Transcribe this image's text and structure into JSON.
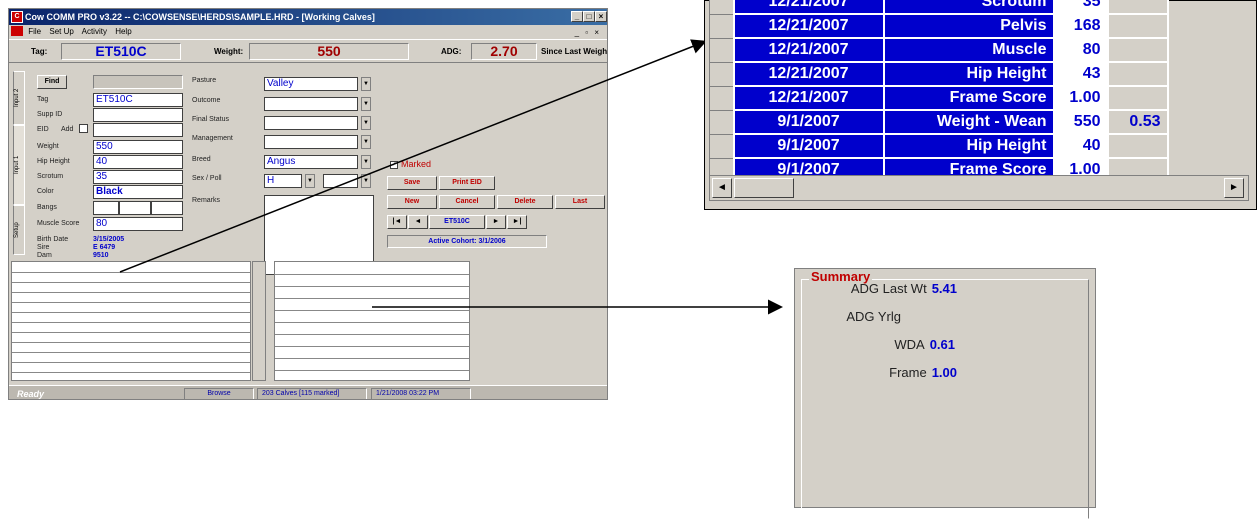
{
  "window": {
    "title": "Cow COMM PRO v3.22 -- C:\\COWSENSE\\HERDS\\SAMPLE.HRD - [Working Calves]",
    "menu": [
      "File",
      "Set Up",
      "Activity",
      "Help"
    ]
  },
  "infobar": {
    "tag_label": "Tag:",
    "tag_value": "ET510C",
    "weight_label": "Weight:",
    "weight_value": "550",
    "adg_label": "ADG:",
    "adg_value": "2.70",
    "since_label": "Since Last Weigh"
  },
  "tabs": [
    "Input 2",
    "Input 1",
    "Setup"
  ],
  "form": {
    "find_button": "Find",
    "tag_label": "Tag",
    "tag_value": "ET510C",
    "supp_label": "Supp ID",
    "eid_label": "EID",
    "add_label": "Add",
    "weight_label": "Weight",
    "weight_value": "550",
    "hip_label": "Hip Height",
    "hip_value": "40",
    "scrotum_label": "Scrotum",
    "scrotum_value": "35",
    "color_label": "Color",
    "color_value": "Black",
    "bangs_label": "Bangs",
    "muscle_label": "Muscle Score",
    "muscle_value": "80",
    "birth_label": "Birth Date",
    "birth_value": "3/15/2005",
    "sire_label": "Sire",
    "sire_value": "E 6479",
    "dam_label": "Dam",
    "dam_value": "9510",
    "pasture_label": "Pasture",
    "pasture_value": "Valley",
    "outcome_label": "Outcome",
    "final_label": "Final Status",
    "mgmt_label": "Management",
    "breed_label": "Breed",
    "breed_value": "Angus",
    "sex_label": "Sex / Poll",
    "sex_value": "H",
    "remarks_label": "Remarks",
    "marked_label": "Marked"
  },
  "buttons": {
    "save": "Save",
    "print_eid": "Print EID",
    "new": "New",
    "cancel": "Cancel",
    "delete": "Delete",
    "last": "Last",
    "nav_first": "|◄",
    "nav_prev": "◄",
    "nav_current": "ET510C",
    "nav_next": "►",
    "nav_last": "►|"
  },
  "cohort": "Active Cohort: 3/1/2006",
  "statusbar": {
    "ready": "Ready",
    "mode": "Browse",
    "count": "203 Calves [115 marked]",
    "datetime": "1/21/2008   03:22 PM"
  },
  "grid": {
    "rows": [
      {
        "date": "12/21/2007",
        "trait": "Scrotum",
        "value": "35",
        "extra": ""
      },
      {
        "date": "12/21/2007",
        "trait": "Pelvis",
        "value": "168",
        "extra": ""
      },
      {
        "date": "12/21/2007",
        "trait": "Muscle",
        "value": "80",
        "extra": ""
      },
      {
        "date": "12/21/2007",
        "trait": "Hip Height",
        "value": "43",
        "extra": ""
      },
      {
        "date": "12/21/2007",
        "trait": "Frame Score",
        "value": "1.00",
        "extra": ""
      },
      {
        "date": "9/1/2007",
        "trait": "Weight - Wean",
        "value": "550",
        "extra": "0.53"
      },
      {
        "date": "9/1/2007",
        "trait": "Hip Height",
        "value": "40",
        "extra": ""
      },
      {
        "date": "9/1/2007",
        "trait": "Frame Score",
        "value": "1.00",
        "extra": ""
      }
    ]
  },
  "summary": {
    "title": "Summary",
    "rows": [
      {
        "label": "ADG Last Wt",
        "value": "5.41"
      },
      {
        "label": "ADG Yrlg",
        "value": ""
      },
      {
        "label": "WDA",
        "value": "0.61"
      },
      {
        "label": "Frame",
        "value": "1.00"
      }
    ]
  },
  "colors": {
    "accent_blue": "#0000cc",
    "accent_red": "#c00000",
    "title_bar": "#0a246a",
    "face": "#d4d0c8"
  }
}
